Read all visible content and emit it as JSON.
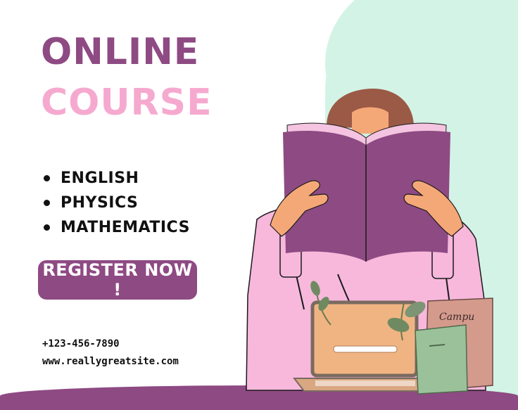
{
  "headline": {
    "line1": "ONLINE",
    "line2": "COURSE"
  },
  "subjects": [
    "ENGLISH",
    "PHYSICS",
    "MATHEMATICS"
  ],
  "cta": {
    "label": "REGISTER NOW !"
  },
  "contact": {
    "phone": "+123-456-7890",
    "website": "www.reallygreatsite.com"
  },
  "illustration": {
    "book_label": "Campu"
  },
  "colors": {
    "purple": "#8e4a83",
    "pink": "#f6a9cf",
    "mint": "#d3f3e6",
    "skin": "#f5a877",
    "hair": "#9b5a45"
  }
}
